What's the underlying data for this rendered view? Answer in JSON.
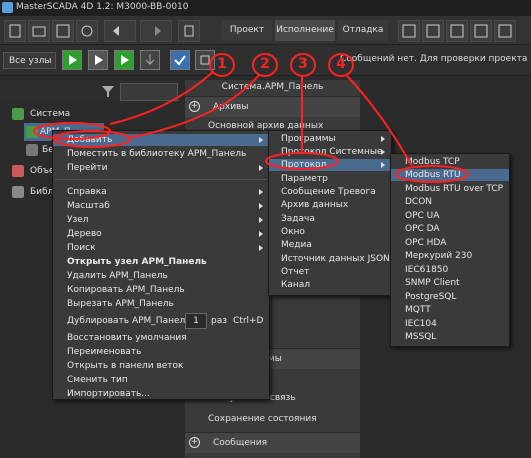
{
  "window": {
    "title": "MasterSCADA 4D 1.2: M3000-BB-0010"
  },
  "tabs": [
    "Проект",
    "Исполнение",
    "Отладка"
  ],
  "toolbar2": {
    "nodes_select": "Все узлы",
    "status_message": "Сообщений нет. Для проверки проекта нажм"
  },
  "tree": {
    "root": "Система",
    "arm": "АРМ_П",
    "item2": "Без",
    "objects": "Объе",
    "library": "Библи"
  },
  "panel": {
    "title": "Система.АРМ_Панель",
    "sections": {
      "archives": "Архивы",
      "main_archive": "Основной архив данных",
      "interlink": "Межузловая связь",
      "save_state": "Сохранение состояния",
      "messages": "Сообщения",
      "partial": "мы"
    }
  },
  "context_menu": {
    "items": [
      "Добавить",
      "Поместить в библиотеку АРМ_Панель",
      "Перейти",
      "Справка",
      "Масштаб",
      "Узел",
      "Дерево",
      "Поиск",
      "Открыть узел АРМ_Панель",
      "Удалить АРМ_Панель",
      "Копировать АРМ_Панель",
      "Вырезать АРМ_Панель",
      "Дублировать АРМ_Панель",
      "Восстановить умолчания",
      "Переименовать",
      "Открыть в панели веток",
      "Сменить тип",
      "Импортировать..."
    ],
    "dup_count": "1",
    "dup_unit": "раз",
    "dup_shortcut": "Ctrl+D"
  },
  "submenu_add": {
    "items": [
      "Программы",
      "Протокол Системные",
      "Протокол",
      "Параметр",
      "Сообщение Тревога",
      "Архив данных",
      "Задача",
      "Окно",
      "Медиа",
      "Источник данных JSON",
      "Отчет",
      "Канал"
    ]
  },
  "submenu_protocol": {
    "items": [
      "Modbus TCP",
      "Modbus RTU",
      "Modbus RTU over TCP",
      "DCON",
      "OPC UA",
      "OPC DA",
      "OPC HDA",
      "Меркурий 230",
      "IEC61850",
      "SNMP Client",
      "PostgreSQL",
      "MQTT",
      "IEC104",
      "MSSQL"
    ]
  },
  "annotations": [
    "1",
    "2",
    "3",
    "4"
  ],
  "colors": {
    "highlight": "#4b6a8f",
    "annotation": "#ff2020",
    "play_green": "#2e9e2e"
  }
}
